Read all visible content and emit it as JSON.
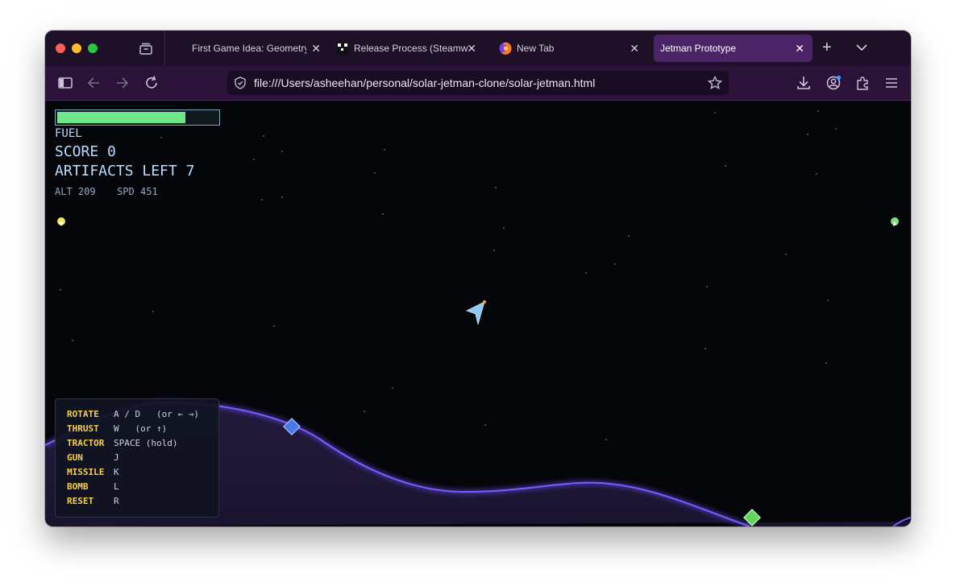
{
  "browser": {
    "tabs": [
      {
        "label": "First Game Idea: Geometry",
        "favicon": "none",
        "active": false
      },
      {
        "label": "Release Process (Steamworks",
        "favicon": "steam-qr-icon",
        "active": false
      },
      {
        "label": "New Tab",
        "favicon": "firefox-icon",
        "active": false
      },
      {
        "label": "Jetman Prototype",
        "favicon": "none",
        "active": true
      }
    ],
    "url": "file:///Users/asheehan/personal/solar-jetman-clone/solar-jetman.html",
    "close_glyph": "✕",
    "new_tab_glyph": "+"
  },
  "hud": {
    "fuel_label": "FUEL",
    "fuel_level": 0.8,
    "score_label": "SCORE",
    "score_value": "0",
    "artifacts_label": "ARTIFACTS LEFT",
    "artifacts_value": "7",
    "alt_label": "ALT",
    "alt_value": "209",
    "spd_label": "SPD",
    "spd_value": "451"
  },
  "controls": [
    {
      "key": "ROTATE",
      "value": "A / D   (or ← →)"
    },
    {
      "key": "THRUST",
      "value": "W   (or ↑)"
    },
    {
      "key": "TRACTOR",
      "value": "SPACE (hold)"
    },
    {
      "key": "GUN",
      "value": "J"
    },
    {
      "key": "MISSILE",
      "value": "K"
    },
    {
      "key": "BOMB",
      "value": "L"
    },
    {
      "key": "RESET",
      "value": "R"
    }
  ],
  "colors": {
    "tab_bg": "#1d1027",
    "tab_active": "#4a2466",
    "toolbar_bg": "#2b1238",
    "fuel": "#6ee88a",
    "terrain_line": "#7b5cff",
    "artifact_blue": "#4a78e6",
    "artifact_green": "#5fd45f",
    "ship": "#8fc8f2",
    "help_key": "#f5cf4f"
  }
}
